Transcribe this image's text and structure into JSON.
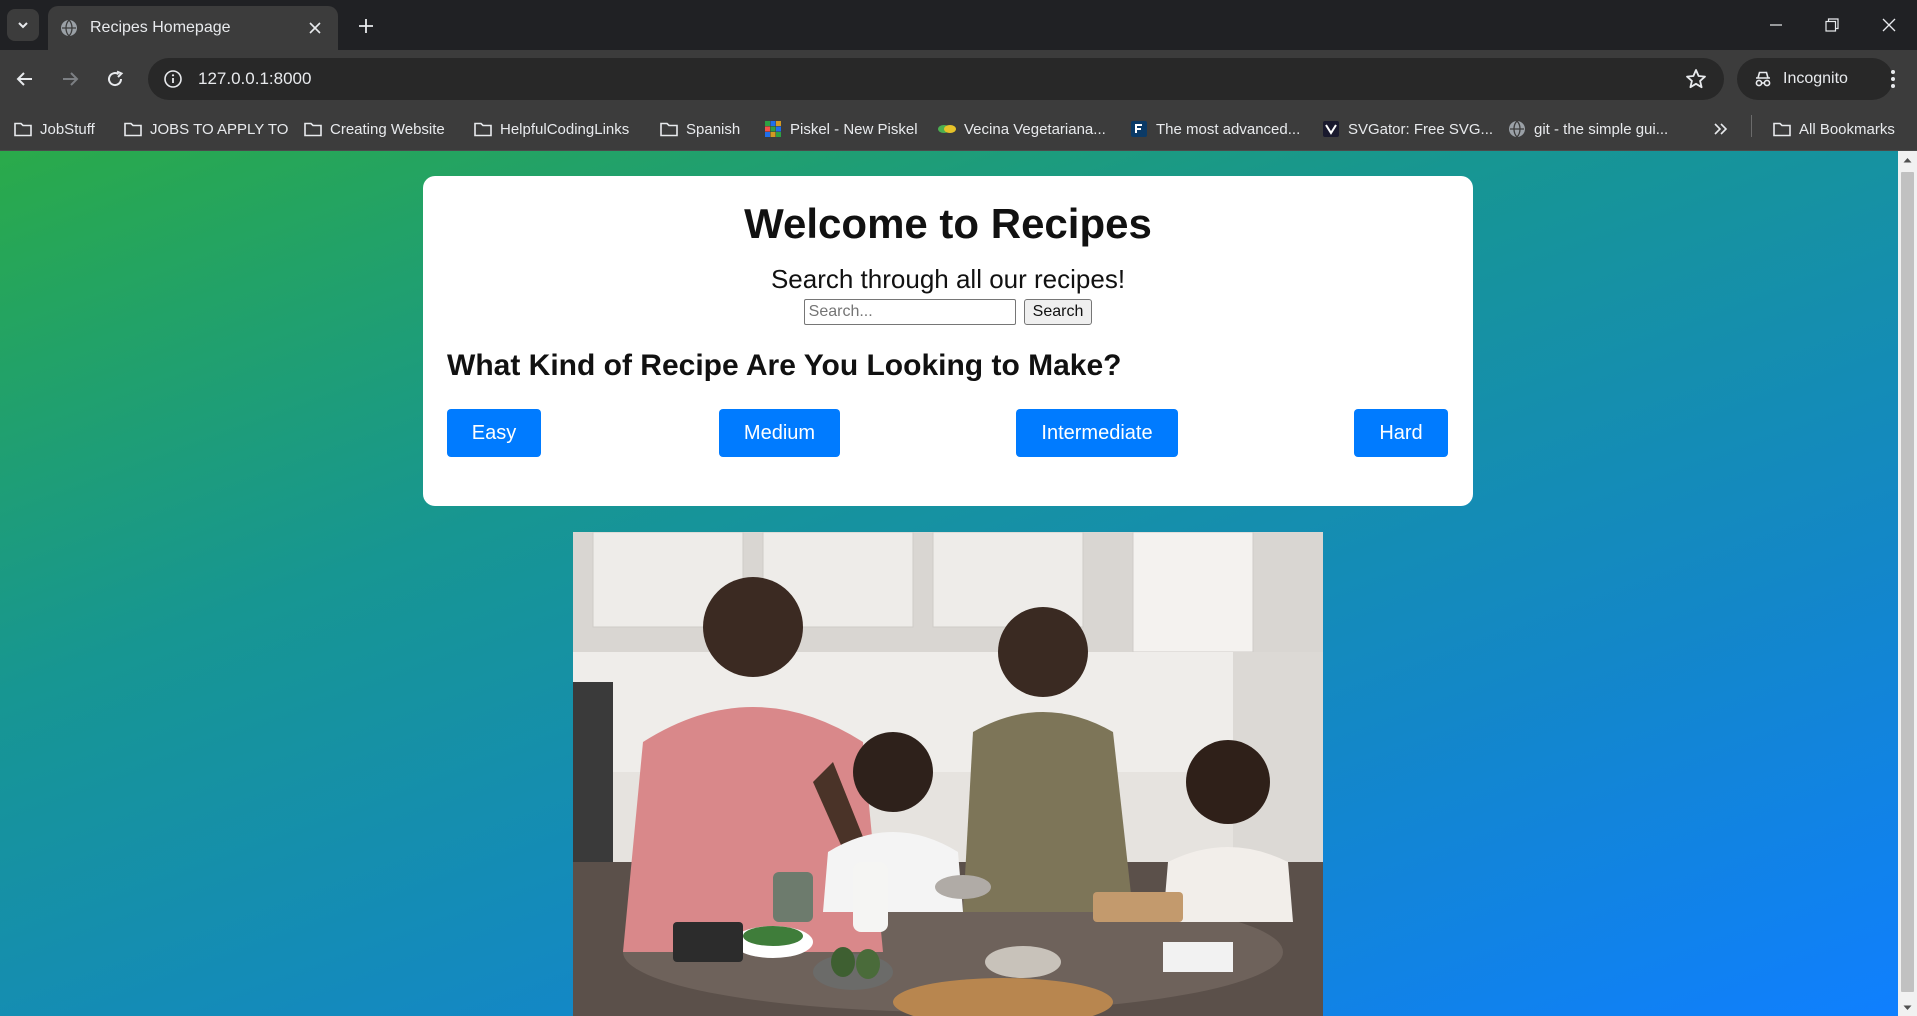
{
  "browser": {
    "tab": {
      "title": "Recipes Homepage"
    },
    "address": {
      "url": "127.0.0.1:8000"
    },
    "profile_label": "Incognito",
    "bookmarks": [
      {
        "label": "JobStuff",
        "icon": "folder-icon"
      },
      {
        "label": "JOBS TO APPLY TO",
        "icon": "folder-icon"
      },
      {
        "label": "Creating Website",
        "icon": "folder-icon"
      },
      {
        "label": "HelpfulCodingLinks",
        "icon": "folder-icon"
      },
      {
        "label": "Spanish",
        "icon": "folder-icon"
      },
      {
        "label": "Piskel - New Piskel",
        "icon": "piskel-favicon"
      },
      {
        "label": "Vecina Vegetariana...",
        "icon": "vecina-favicon"
      },
      {
        "label": "The most advanced...",
        "icon": "f-favicon"
      },
      {
        "label": "SVGator: Free SVG...",
        "icon": "svgator-favicon"
      },
      {
        "label": "git - the simple gui...",
        "icon": "globe-icon"
      }
    ],
    "all_bookmarks_label": "All Bookmarks"
  },
  "page": {
    "title": "Welcome to Recipes",
    "subtitle": "Search through all our recipes!",
    "search": {
      "placeholder": "Search...",
      "button_label": "Search"
    },
    "question": "What Kind of Recipe Are You Looking to Make?",
    "difficulty_buttons": [
      "Easy",
      "Medium",
      "Intermediate",
      "Hard"
    ]
  },
  "colors": {
    "button_blue": "#007bff",
    "gradient_start": "#2aaa4a",
    "gradient_end": "#0f7fff",
    "chrome_dark": "#202124",
    "chrome_toolbar": "#3c3c3c"
  }
}
